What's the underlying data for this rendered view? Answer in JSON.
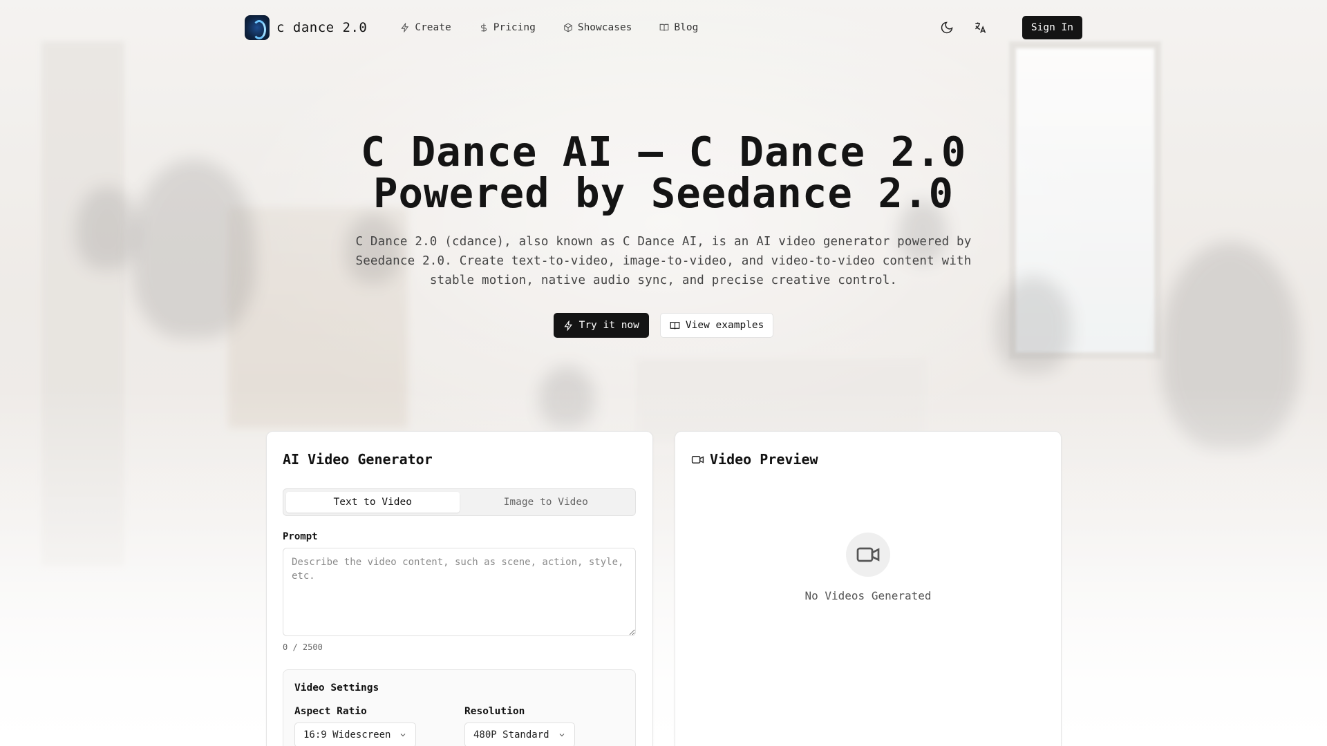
{
  "header": {
    "brand_name": "c dance 2.0",
    "nav": [
      {
        "label": "Create",
        "icon": "lightning-icon"
      },
      {
        "label": "Pricing",
        "icon": "dollar-icon"
      },
      {
        "label": "Showcases",
        "icon": "cube-icon"
      },
      {
        "label": "Blog",
        "icon": "book-icon"
      }
    ],
    "sign_in_label": "Sign In"
  },
  "hero": {
    "title_line1": "C Dance AI — C Dance 2.0",
    "title_line2": "Powered by Seedance 2.0",
    "description": "C Dance 2.0 (cdance), also known as C Dance AI, is an AI video generator powered by Seedance 2.0. Create text-to-video, image-to-video, and video-to-video content with stable motion, native audio sync, and precise creative control.",
    "try_label": "Try it now",
    "examples_label": "View examples"
  },
  "generator": {
    "title": "AI Video Generator",
    "tabs": [
      {
        "label": "Text to Video",
        "active": true
      },
      {
        "label": "Image to Video",
        "active": false
      }
    ],
    "prompt_label": "Prompt",
    "prompt_value": "",
    "prompt_placeholder": "Describe the video content, such as scene, action, style, etc.",
    "char_count": "0 / 2500",
    "settings": {
      "title": "Video Settings",
      "aspect_label": "Aspect Ratio",
      "aspect_value": "16:9 Widescreen",
      "resolution_label": "Resolution",
      "resolution_value": "480P Standard"
    }
  },
  "preview": {
    "title": "Video Preview",
    "empty_text": "No Videos Generated"
  },
  "colors": {
    "primary": "#141414",
    "background": "#f4f2ef",
    "card": "#ffffff"
  }
}
